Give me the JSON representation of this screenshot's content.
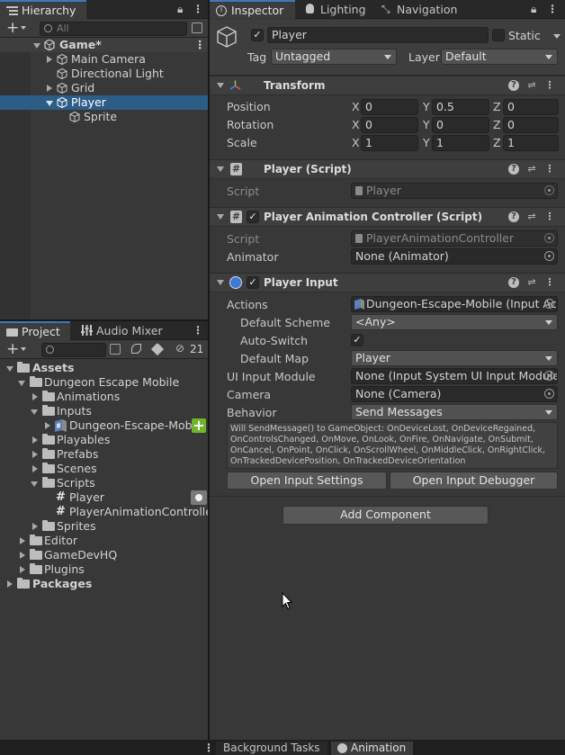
{
  "hierarchy": {
    "tab_label": "Hierarchy",
    "search_placeholder": "All",
    "add_label": "+",
    "items": [
      {
        "label": "Game*"
      },
      {
        "label": "Main Camera"
      },
      {
        "label": "Directional Light"
      },
      {
        "label": "Grid"
      },
      {
        "label": "Player"
      },
      {
        "label": "Sprite"
      }
    ]
  },
  "project": {
    "tabs": [
      {
        "label": "Project"
      },
      {
        "label": "Audio Mixer"
      }
    ],
    "hidden_count": "21",
    "add_label": "+",
    "items": [
      {
        "label": "Assets"
      },
      {
        "label": "Dungeon Escape Mobile"
      },
      {
        "label": "Animations"
      },
      {
        "label": "Inputs"
      },
      {
        "label": "Dungeon-Escape-Mobile"
      },
      {
        "label": "Playables"
      },
      {
        "label": "Prefabs"
      },
      {
        "label": "Scenes"
      },
      {
        "label": "Scripts"
      },
      {
        "label": "Player"
      },
      {
        "label": "PlayerAnimationController"
      },
      {
        "label": "Sprites"
      },
      {
        "label": "Editor"
      },
      {
        "label": "GameDevHQ"
      },
      {
        "label": "Plugins"
      },
      {
        "label": "Packages"
      }
    ]
  },
  "inspector": {
    "tabs": [
      {
        "label": "Inspector"
      },
      {
        "label": "Lighting"
      },
      {
        "label": "Navigation"
      }
    ],
    "object_name": "Player",
    "static_label": "Static",
    "tag_label": "Tag",
    "tag_value": "Untagged",
    "layer_label": "Layer",
    "layer_value": "Default",
    "transform": {
      "title": "Transform",
      "position_label": "Position",
      "rotation_label": "Rotation",
      "scale_label": "Scale",
      "x": "X",
      "y": "Y",
      "z": "Z",
      "position": [
        "0",
        "0.5",
        "0"
      ],
      "rotation": [
        "0",
        "0",
        "0"
      ],
      "scale": [
        "1",
        "1",
        "1"
      ]
    },
    "player_script": {
      "title": "Player (Script)",
      "script_label": "Script",
      "script_value": "Player"
    },
    "anim_controller": {
      "title": "Player Animation Controller (Script)",
      "script_label": "Script",
      "script_value": "PlayerAnimationController",
      "animator_label": "Animator",
      "animator_value": "None (Animator)"
    },
    "player_input": {
      "title": "Player Input",
      "actions_label": "Actions",
      "actions_value": "Dungeon-Escape-Mobile (Input Ac",
      "default_scheme_label": "Default Scheme",
      "default_scheme_value": "<Any>",
      "auto_switch_label": "Auto-Switch",
      "auto_switch_check": "✓",
      "default_map_label": "Default Map",
      "default_map_value": "Player",
      "ui_input_module_label": "UI Input Module",
      "ui_input_module_value": "None (Input System UI Input Module)",
      "camera_label": "Camera",
      "camera_value": "None (Camera)",
      "behavior_label": "Behavior",
      "behavior_value": "Send Messages",
      "info_lines": [
        "Will SendMessage() to GameObject: OnDeviceLost, OnDeviceRegained,",
        "OnControlsChanged, OnMove, OnLook, OnFire, OnNavigate, OnSubmit,",
        "OnCancel, OnPoint, OnClick, OnScrollWheel, OnMiddleClick, OnRightClick,",
        "OnTrackedDevicePosition, OnTrackedDeviceOrientation"
      ],
      "open_settings_label": "Open Input Settings",
      "open_debugger_label": "Open Input Debugger"
    },
    "add_component_label": "Add Component",
    "enabled_check": "✓"
  },
  "bottom_tabs": [
    {
      "label": "Background Tasks"
    },
    {
      "label": "Animation"
    }
  ]
}
